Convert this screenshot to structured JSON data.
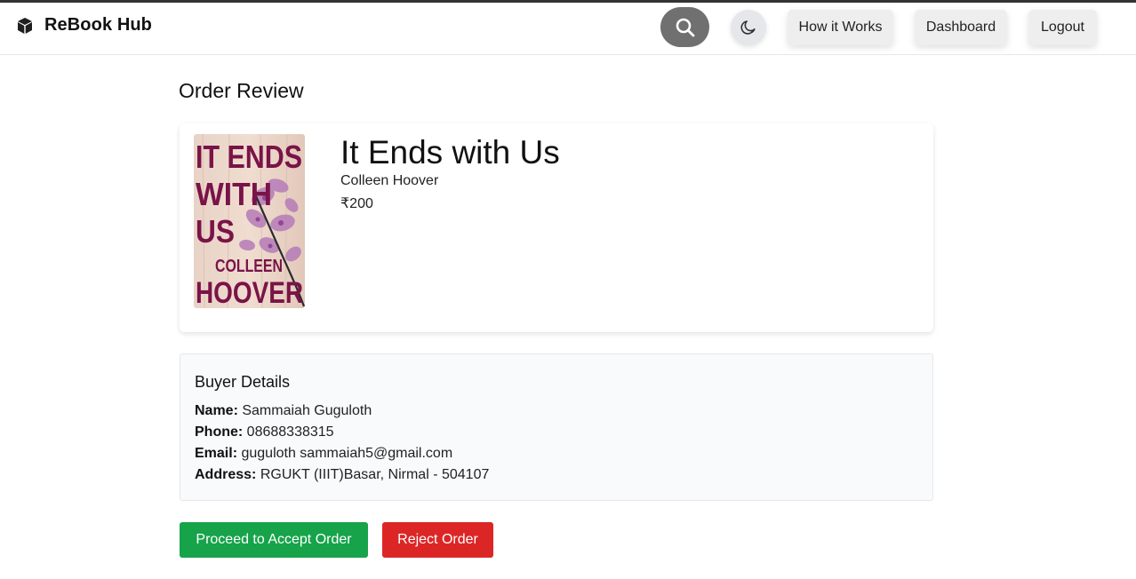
{
  "app": {
    "name": "ReBook Hub",
    "brand_icon": "cube-icon"
  },
  "nav": {
    "search_icon": "search-icon",
    "theme_icon": "moon-icon",
    "how_it_works": "How it Works",
    "dashboard": "Dashboard",
    "logout": "Logout"
  },
  "page": {
    "title": "Order Review"
  },
  "book": {
    "title": "It Ends with Us",
    "author": "Colleen Hoover",
    "price": "₹200",
    "cover_text": [
      "IT ENDS",
      "WITH",
      "US",
      "COLLEEN",
      "HOOVER"
    ]
  },
  "buyer": {
    "heading": "Buyer Details",
    "name_label": "Name:",
    "name": "Sammaiah Guguloth",
    "phone_label": "Phone:",
    "phone": "08688338315",
    "email_label": "Email:",
    "email": "guguloth sammaiah5@gmail.com",
    "address_label": "Address:",
    "address": "RGUKT (IIIT)Basar, Nirmal - 504107"
  },
  "actions": {
    "accept": "Proceed to Accept Order",
    "reject": "Reject Order"
  },
  "colors": {
    "accept": "#16a34a",
    "reject": "#dc2626",
    "search_button": "#707070",
    "cover_text": "#7a1348"
  }
}
